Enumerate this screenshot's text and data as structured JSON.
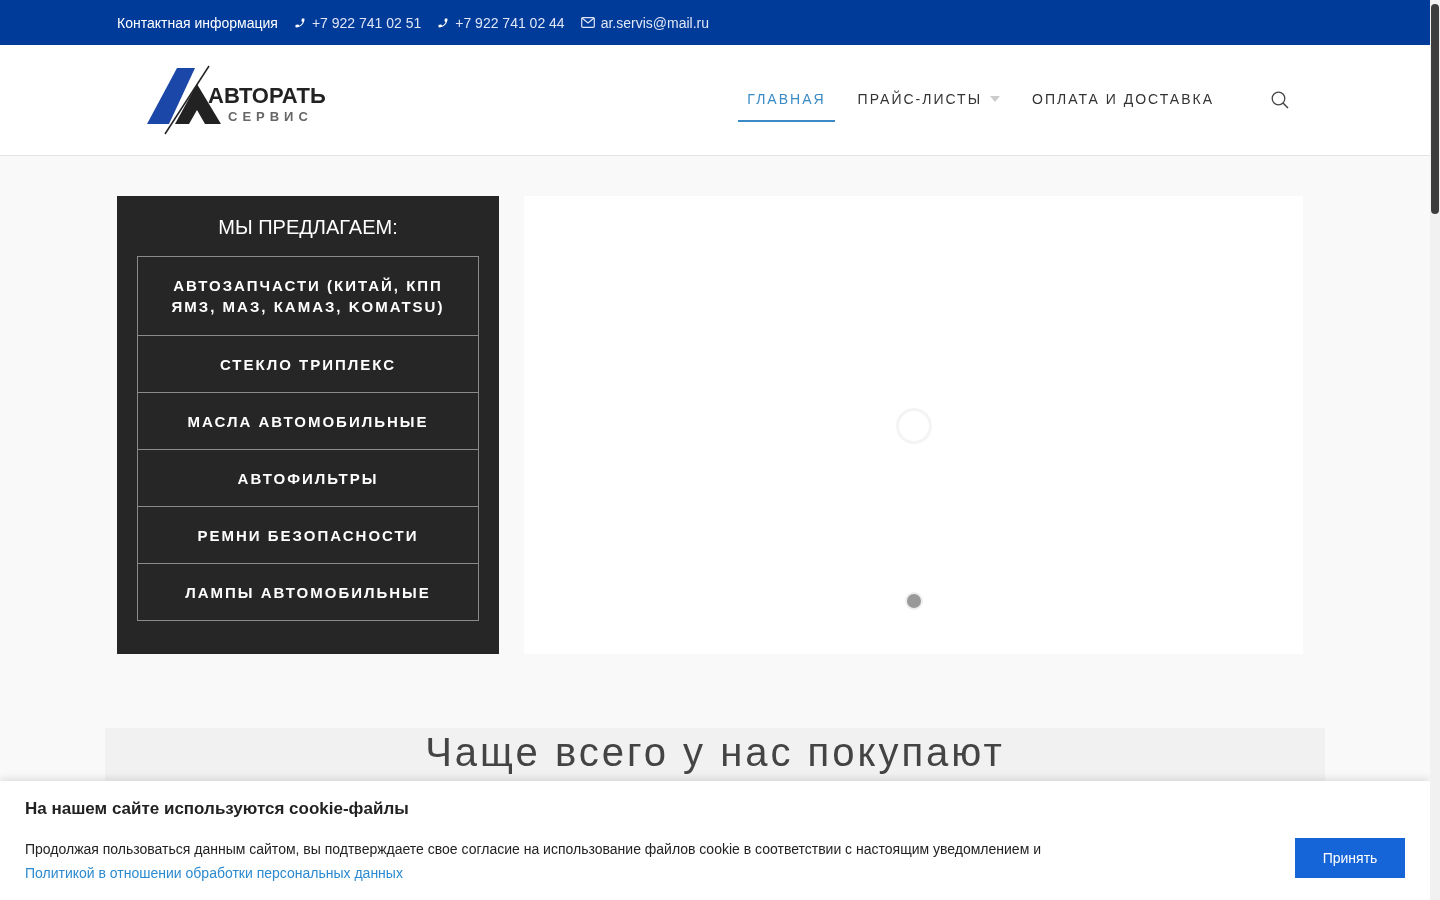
{
  "topbar": {
    "contact_label": "Контактная информация",
    "phones": [
      "+7 922 741 02 51",
      "+7 922 741 02 44"
    ],
    "email": "ar.servis@mail.ru"
  },
  "logo": {
    "name": "АВТОРАТЬ",
    "subtitle": "СЕРВИС"
  },
  "nav": [
    {
      "label": "ГЛАВНАЯ",
      "selected": true,
      "dropdown": false
    },
    {
      "label": "ПРАЙС-ЛИСТЫ",
      "selected": false,
      "dropdown": true
    },
    {
      "label": "ОПЛАТА И ДОСТАВКА",
      "selected": false,
      "dropdown": false
    }
  ],
  "offers": {
    "title": "МЫ ПРЕДЛАГАЕМ:",
    "items": [
      "АВТОЗАПЧАСТИ (КИТАЙ, КПП ЯМЗ, МАЗ, КАМАЗ, KOMATSU)",
      "СТЕКЛО ТРИПЛЕКС",
      "МАСЛА АВТОМОБИЛЬНЫЕ",
      "АВТОФИЛЬТРЫ",
      "РЕМНИ БЕЗОПАСНОСТИ",
      "ЛАМПЫ АВТОМОБИЛЬНЫЕ"
    ]
  },
  "slider": {
    "dots": [
      {
        "selected": true
      }
    ]
  },
  "popular": {
    "title": "Чаще всего у нас покупают"
  },
  "cookie": {
    "title": "На нашем сайте используются cookie-файлы",
    "text": "Продолжая пользоваться данным сайтом, вы подтверждаете свое согласие на использование файлов cookie в соответствии с настоящим уведомлением и ",
    "link": "Политикой в отношении обработки персональных данных",
    "button": "Принять"
  }
}
